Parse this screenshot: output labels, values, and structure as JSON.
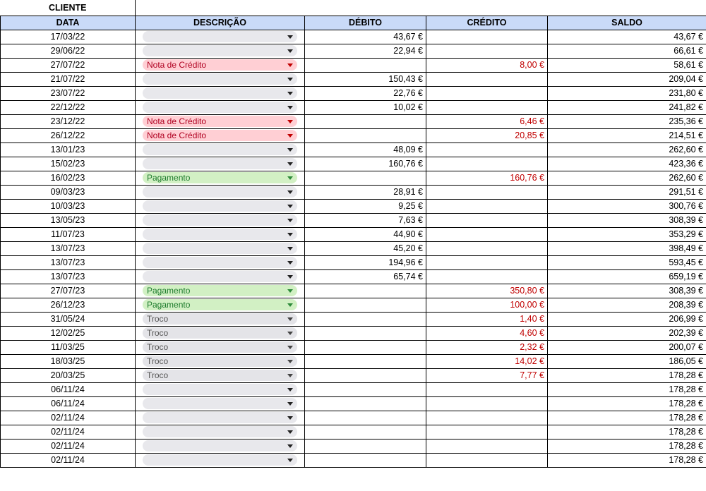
{
  "sheet": {
    "title": "CLIENTE",
    "headers": [
      "DATA",
      "DESCRIÇÃO",
      "DÉBITO",
      "CRÉDITO",
      "SALDO"
    ],
    "rows": [
      {
        "date": "17/03/22",
        "desc": "",
        "debit": "43,67 €",
        "credit": "",
        "balance": "43,67 €"
      },
      {
        "date": "29/06/22",
        "desc": "",
        "debit": "22,94 €",
        "credit": "",
        "balance": "66,61 €"
      },
      {
        "date": "27/07/22",
        "desc": "Nota de Crédito",
        "debit": "",
        "credit": "8,00 €",
        "balance": "58,61 €"
      },
      {
        "date": "21/07/22",
        "desc": "",
        "debit": "150,43 €",
        "credit": "",
        "balance": "209,04 €"
      },
      {
        "date": "23/07/22",
        "desc": "",
        "debit": "22,76 €",
        "credit": "",
        "balance": "231,80 €"
      },
      {
        "date": "22/12/22",
        "desc": "",
        "debit": "10,02 €",
        "credit": "",
        "balance": "241,82 €"
      },
      {
        "date": "23/12/22",
        "desc": "Nota de Crédito",
        "debit": "",
        "credit": "6,46 €",
        "balance": "235,36 €"
      },
      {
        "date": "26/12/22",
        "desc": "Nota de Crédito",
        "debit": "",
        "credit": "20,85 €",
        "balance": "214,51 €"
      },
      {
        "date": "13/01/23",
        "desc": "",
        "debit": "48,09 €",
        "credit": "",
        "balance": "262,60 €"
      },
      {
        "date": "15/02/23",
        "desc": "",
        "debit": "160,76 €",
        "credit": "",
        "balance": "423,36 €"
      },
      {
        "date": "16/02/23",
        "desc": "Pagamento",
        "debit": "",
        "credit": "160,76 €",
        "balance": "262,60 €"
      },
      {
        "date": "09/03/23",
        "desc": "",
        "debit": "28,91 €",
        "credit": "",
        "balance": "291,51 €"
      },
      {
        "date": "10/03/23",
        "desc": "",
        "debit": "9,25 €",
        "credit": "",
        "balance": "300,76 €"
      },
      {
        "date": "13/05/23",
        "desc": "",
        "debit": "7,63 €",
        "credit": "",
        "balance": "308,39 €"
      },
      {
        "date": "11/07/23",
        "desc": "",
        "debit": "44,90 €",
        "credit": "",
        "balance": "353,29 €"
      },
      {
        "date": "13/07/23",
        "desc": "",
        "debit": "45,20 €",
        "credit": "",
        "balance": "398,49 €"
      },
      {
        "date": "13/07/23",
        "desc": "",
        "debit": "194,96 €",
        "credit": "",
        "balance": "593,45 €"
      },
      {
        "date": "13/07/23",
        "desc": "",
        "debit": "65,74 €",
        "credit": "",
        "balance": "659,19 €"
      },
      {
        "date": "27/07/23",
        "desc": "Pagamento",
        "debit": "",
        "credit": "350,80 €",
        "balance": "308,39 €"
      },
      {
        "date": "26/12/23",
        "desc": "Pagamento",
        "debit": "",
        "credit": "100,00 €",
        "balance": "208,39 €"
      },
      {
        "date": "31/05/24",
        "desc": "Troco",
        "debit": "",
        "credit": "1,40 €",
        "balance": "206,99 €"
      },
      {
        "date": "12/02/25",
        "desc": "Troco",
        "debit": "",
        "credit": "4,60 €",
        "balance": "202,39 €"
      },
      {
        "date": "11/03/25",
        "desc": "Troco",
        "debit": "",
        "credit": "2,32 €",
        "balance": "200,07 €"
      },
      {
        "date": "18/03/25",
        "desc": "Troco",
        "debit": "",
        "credit": "14,02 €",
        "balance": "186,05 €"
      },
      {
        "date": "20/03/25",
        "desc": "Troco",
        "debit": "",
        "credit": "7,77 €",
        "balance": "178,28 €"
      },
      {
        "date": "06/11/24",
        "desc": "",
        "debit": "",
        "credit": "",
        "balance": "178,28 €"
      },
      {
        "date": "06/11/24",
        "desc": "",
        "debit": "",
        "credit": "",
        "balance": "178,28 €"
      },
      {
        "date": "02/11/24",
        "desc": "",
        "debit": "",
        "credit": "",
        "balance": "178,28 €"
      },
      {
        "date": "02/11/24",
        "desc": "",
        "debit": "",
        "credit": "",
        "balance": "178,28 €"
      },
      {
        "date": "02/11/24",
        "desc": "",
        "debit": "",
        "credit": "",
        "balance": "178,28 €"
      },
      {
        "date": "02/11/24",
        "desc": "",
        "debit": "",
        "credit": "",
        "balance": "178,28 €"
      }
    ]
  },
  "colors": {
    "header_bg": "#c9daf8",
    "credit_text": "#c00000",
    "nota_chip": "#ffcfd4",
    "pagamento_chip": "#d2f0c4",
    "troco_chip": "#e4e4e8",
    "empty_chip": "#e8e8ec"
  },
  "icons": {
    "dropdown": "chevron-down-icon"
  }
}
